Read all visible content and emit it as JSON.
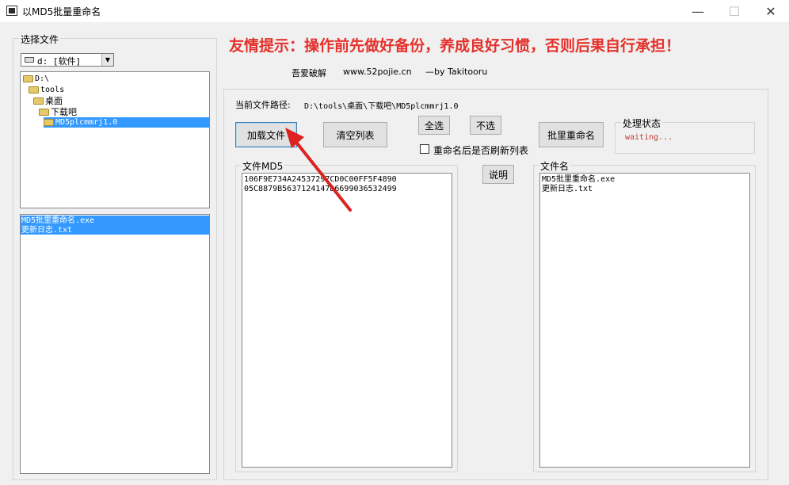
{
  "window": {
    "title": "以MD5批量重命名"
  },
  "colors": {
    "warning": "#e5312b",
    "status": "#c0392b",
    "selection": "#3399ff",
    "arrow": "#dd2222"
  },
  "left": {
    "select_label": "选择文件",
    "drive_value": "d: [软件]",
    "tree": [
      "D:\\",
      "tools",
      "桌面",
      "下载吧",
      "MD5plcmmrj1.0"
    ],
    "files": [
      "MD5批里重命名.exe",
      "更新日志.txt"
    ]
  },
  "header": {
    "warning": "友情提示：操作前先做好备份，养成良好习惯，否则后果自行承担！",
    "credit_site": "吾爱破解",
    "credit_url": "www.52pojie.cn",
    "credit_by": "—by Takitooru"
  },
  "main": {
    "path_label": "当前文件路径:",
    "path_value": "D:\\tools\\桌面\\下载吧\\MD5plcmmrj1.0",
    "buttons": {
      "load": "加载文件",
      "clear": "清空列表",
      "select_all": "全选",
      "deselect": "不选",
      "batch_rename": "批里重命名",
      "help": "说明"
    },
    "refresh_checkbox": "重命名后是否刷新列表",
    "status_label": "处理状态",
    "status_value": "waiting...",
    "md5_label": "文件MD5",
    "md5_values": [
      "106F9E734A24537297CD0C00FF5F4890",
      "05C8879B5637124147D6699036532499"
    ],
    "filename_label": "文件名",
    "filenames": [
      "MD5批里重命名.exe",
      "更新日志.txt"
    ]
  }
}
